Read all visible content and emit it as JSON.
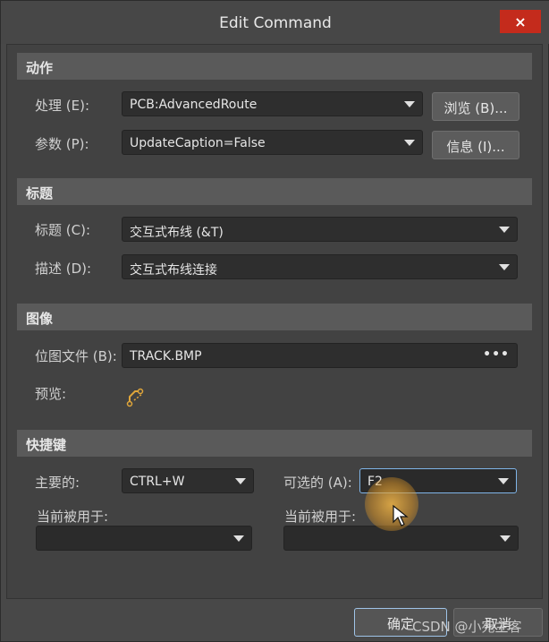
{
  "window": {
    "title": "Edit Command",
    "close_icon": "×"
  },
  "sections": {
    "action": {
      "header": "动作",
      "process_label": "处理 (E):",
      "process_value": "PCB:AdvancedRoute",
      "browse_button": "浏览 (B)...",
      "params_label": "参数 (P):",
      "params_value": "UpdateCaption=False",
      "info_button": "信息 (I)..."
    },
    "title": {
      "header": "标题",
      "caption_label": "标题 (C):",
      "caption_value": "交互式布线 (&T)",
      "description_label": "描述 (D):",
      "description_value": "交互式布线连接"
    },
    "image": {
      "header": "图像",
      "bitmap_label": "位图文件 (B):",
      "bitmap_value": "TRACK.BMP",
      "bitmap_more": "•••",
      "preview_label": "预览:"
    },
    "shortcuts": {
      "header": "快捷键",
      "primary_label": "主要的:",
      "primary_value": "CTRL+W",
      "alternative_label": "可选的 (A):",
      "alternative_value": "F2",
      "primary_used_label": "当前被用于:",
      "alternative_used_label": "当前被用于:"
    }
  },
  "footer": {
    "ok_button": "确定",
    "cancel_button": "取消"
  },
  "watermark": "CSDN @小宛主客"
}
